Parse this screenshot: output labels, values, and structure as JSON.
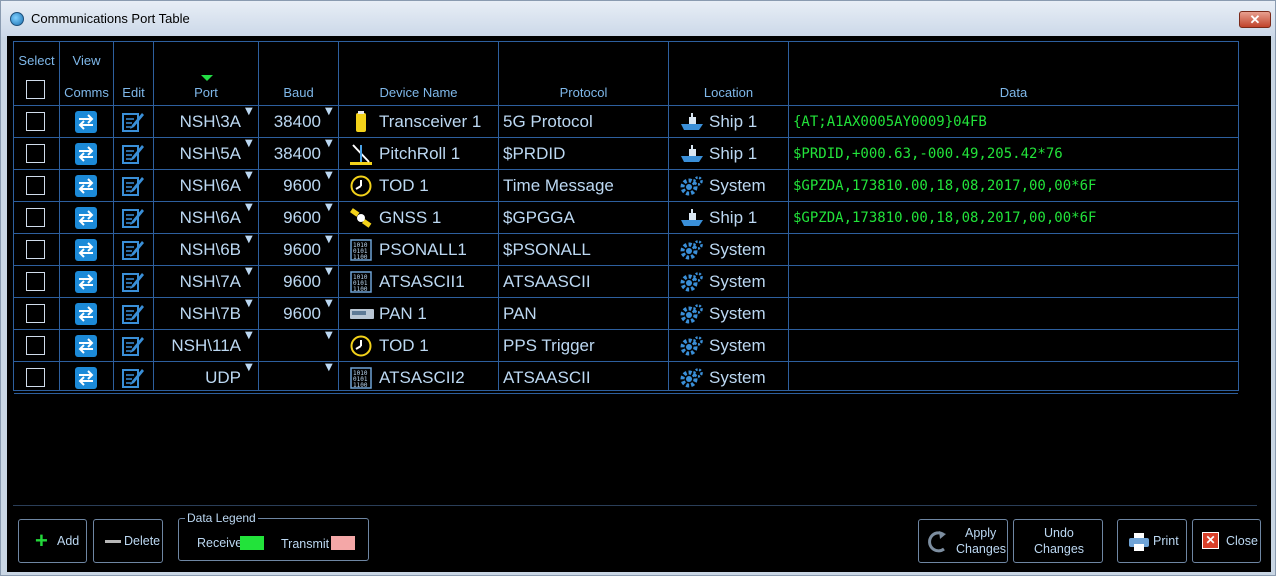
{
  "window": {
    "title": "Communications Port Table",
    "close_label": "✕"
  },
  "columns": {
    "select": "Select",
    "view": "View",
    "comms": "Comms",
    "edit": "Edit",
    "port": "Port",
    "baud": "Baud",
    "device_name": "Device Name",
    "protocol": "Protocol",
    "location": "Location",
    "data": "Data"
  },
  "rows": [
    {
      "port": "NSH\\3A",
      "baud": "38400",
      "device": "Transceiver 1",
      "device_icon": "transceiver-icon",
      "protocol": "5G Protocol",
      "location": "Ship 1",
      "location_icon": "ship-icon",
      "data": "{AT;A1AX0005AY0009}04FB"
    },
    {
      "port": "NSH\\5A",
      "baud": "38400",
      "device": "PitchRoll 1",
      "device_icon": "pitch-roll-icon",
      "protocol": "$PRDID",
      "location": "Ship 1",
      "location_icon": "ship-icon",
      "data": "$PRDID,+000.63,-000.49,205.42*76"
    },
    {
      "port": "NSH\\6A",
      "baud": "9600",
      "device": "TOD 1",
      "device_icon": "clock-icon",
      "protocol": "Time Message",
      "location": "System",
      "location_icon": "gears-icon",
      "data": "$GPZDA,173810.00,18,08,2017,00,00*6F"
    },
    {
      "port": "NSH\\6A",
      "baud": "9600",
      "device": "GNSS 1",
      "device_icon": "satellite-icon",
      "protocol": "$GPGGA",
      "location": "Ship 1",
      "location_icon": "ship-icon",
      "data": "$GPZDA,173810.00,18,08,2017,00,00*6F"
    },
    {
      "port": "NSH\\6B",
      "baud": "9600",
      "device": "PSONALL1",
      "device_icon": "binary-data-icon",
      "protocol": "$PSONALL",
      "location": "System",
      "location_icon": "gears-icon",
      "data": ""
    },
    {
      "port": "NSH\\7A",
      "baud": "9600",
      "device": "ATSASCII1",
      "device_icon": "binary-data-icon",
      "protocol": "ATSAASCII",
      "location": "System",
      "location_icon": "gears-icon",
      "data": ""
    },
    {
      "port": "NSH\\7B",
      "baud": "9600",
      "device": "PAN 1",
      "device_icon": "pan-device-icon",
      "protocol": "PAN",
      "location": "System",
      "location_icon": "gears-icon",
      "data": ""
    },
    {
      "port": "NSH\\11A",
      "baud": "",
      "device": "TOD 1",
      "device_icon": "clock-icon",
      "protocol": "PPS Trigger",
      "location": "System",
      "location_icon": "gears-icon",
      "data": ""
    },
    {
      "port": "UDP",
      "baud": "",
      "device": "ATSASCII2",
      "device_icon": "binary-data-icon",
      "protocol": "ATSAASCII",
      "location": "System",
      "location_icon": "gears-icon",
      "data": ""
    }
  ],
  "toolbar": {
    "add_label": "Add",
    "delete_label": "Delete",
    "legend_title": "Data Legend",
    "receive_label": "Receive",
    "transmit_label": "Transmit",
    "apply_line1": "Apply",
    "apply_line2": "Changes",
    "undo_line1": "Undo",
    "undo_line2": "Changes",
    "print_label": "Print",
    "close_label": "Close"
  },
  "colors": {
    "receive": "#22e33a",
    "transmit": "#f4a7a7",
    "accent": "#2d5f9e"
  }
}
